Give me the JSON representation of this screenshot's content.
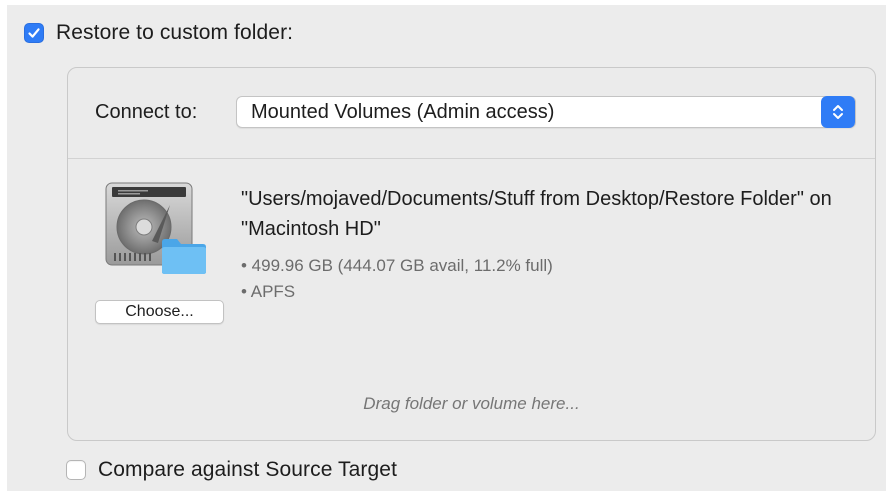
{
  "restore_option": {
    "label": "Restore to custom folder:",
    "checked": true
  },
  "panel": {
    "connect_label": "Connect to:",
    "connect_value": "Mounted Volumes (Admin access)",
    "destination_path": "\"Users/mojaved/Documents/Stuff from Desktop/Restore Folder\" on \"Macintosh HD\"",
    "details": [
      "• 499.96 GB (444.07 GB avail, 11.2% full)",
      "• APFS"
    ],
    "choose_label": "Choose...",
    "drop_hint": "Drag folder or volume here..."
  },
  "compare_option": {
    "label": "Compare against Source Target",
    "checked": false
  },
  "colors": {
    "accent": "#2f7cf6",
    "folder": "#56b3f0",
    "background": "#ececec"
  },
  "icons": {
    "checkbox_checked": "checkmark-icon",
    "stepper": "up-down-chevron-icon",
    "volume": "hard-disk-icon",
    "folder": "folder-icon"
  }
}
